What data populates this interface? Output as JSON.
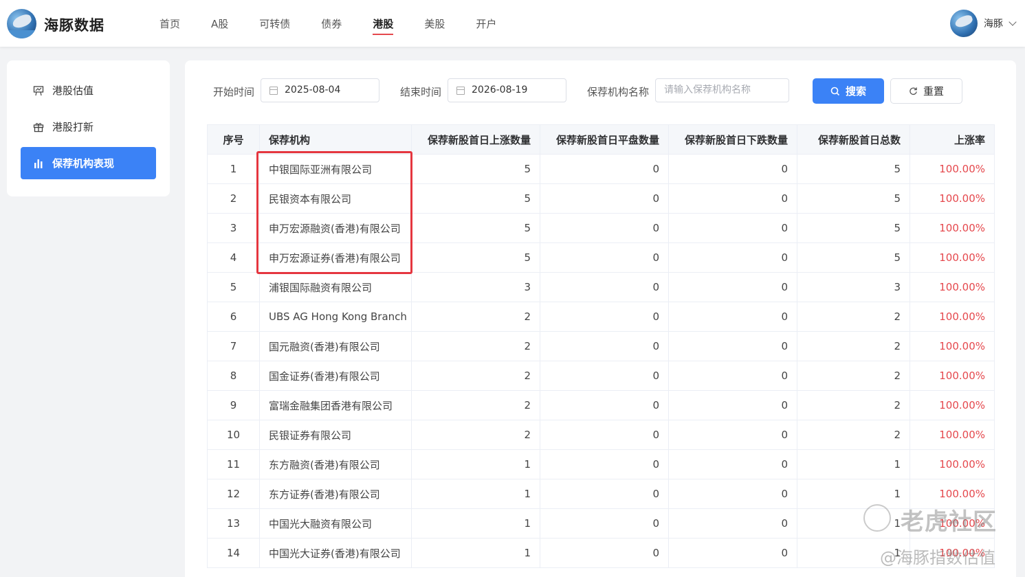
{
  "brand": {
    "name": "海豚数据"
  },
  "nav": {
    "items": [
      "首页",
      "A股",
      "可转债",
      "债券",
      "港股",
      "美股",
      "开户"
    ],
    "active_index": 4
  },
  "user": {
    "name": "海豚"
  },
  "sidebar": {
    "items": [
      {
        "label": "港股估值",
        "icon": "chart-board-icon"
      },
      {
        "label": "港股打新",
        "icon": "gift-icon"
      },
      {
        "label": "保荐机构表现",
        "icon": "bar-chart-icon"
      }
    ],
    "active_index": 2
  },
  "filter": {
    "start_label": "开始时间",
    "start_value": "2025-08-04",
    "end_label": "结束时间",
    "end_value": "2026-08-19",
    "sponsor_label": "保荐机构名称",
    "sponsor_placeholder": "请输入保荐机构名称",
    "search_label": "搜索",
    "reset_label": "重置"
  },
  "table": {
    "headers": [
      "序号",
      "保荐机构",
      "保荐新股首日上涨数量",
      "保荐新股首日平盘数量",
      "保荐新股首日下跌数量",
      "保荐新股首日总数",
      "上涨率"
    ],
    "rows": [
      [
        "1",
        "中银国际亚洲有限公司",
        "5",
        "0",
        "0",
        "5",
        "100.00%"
      ],
      [
        "2",
        "民银资本有限公司",
        "5",
        "0",
        "0",
        "5",
        "100.00%"
      ],
      [
        "3",
        "申万宏源融资(香港)有限公司",
        "5",
        "0",
        "0",
        "5",
        "100.00%"
      ],
      [
        "4",
        "申万宏源证券(香港)有限公司",
        "5",
        "0",
        "0",
        "5",
        "100.00%"
      ],
      [
        "5",
        "浦银国际融资有限公司",
        "3",
        "0",
        "0",
        "3",
        "100.00%"
      ],
      [
        "6",
        "UBS AG Hong Kong Branch",
        "2",
        "0",
        "0",
        "2",
        "100.00%"
      ],
      [
        "7",
        "国元融资(香港)有限公司",
        "2",
        "0",
        "0",
        "2",
        "100.00%"
      ],
      [
        "8",
        "国金证券(香港)有限公司",
        "2",
        "0",
        "0",
        "2",
        "100.00%"
      ],
      [
        "9",
        "富瑞金融集团香港有限公司",
        "2",
        "0",
        "0",
        "2",
        "100.00%"
      ],
      [
        "10",
        "民银证券有限公司",
        "2",
        "0",
        "0",
        "2",
        "100.00%"
      ],
      [
        "11",
        "东方融资(香港)有限公司",
        "1",
        "0",
        "0",
        "1",
        "100.00%"
      ],
      [
        "12",
        "东方证券(香港)有限公司",
        "1",
        "0",
        "0",
        "1",
        "100.00%"
      ],
      [
        "13",
        "中国光大融资有限公司",
        "1",
        "0",
        "0",
        "1",
        "100.00%"
      ],
      [
        "14",
        "中国光大证券(香港)有限公司",
        "1",
        "0",
        "0",
        "1",
        "100.00%"
      ]
    ]
  },
  "watermark": {
    "line1": "老虎社区",
    "line2": "@海豚指数估值"
  },
  "colors": {
    "accent": "#3b82f6",
    "rate": "#e5484d",
    "highlight": "#e5363f"
  }
}
